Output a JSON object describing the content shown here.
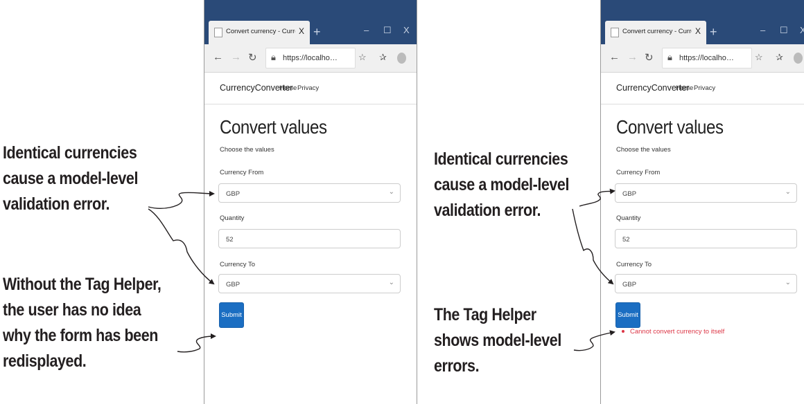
{
  "panels": [
    {
      "annotation_top": [
        "Identical currencies",
        "cause a model-level",
        "validation error."
      ],
      "annotation_bottom": [
        "Without the Tag Helper,",
        "the user has no idea",
        "why the form has been",
        "redisplayed."
      ],
      "browser": {
        "tab_title": "Convert currency - CurrencyConv",
        "tab_close": "X",
        "new_tab": "+",
        "url": "https://localho…",
        "brand": "CurrencyConverter",
        "nav_home": "Home",
        "nav_privacy": "Privacy",
        "heading": "Convert values",
        "subheading": "Choose the values",
        "currency_from_label": "Currency From",
        "currency_from_value": "GBP",
        "quantity_label": "Quantity",
        "quantity_value": "52",
        "currency_to_label": "Currency To",
        "currency_to_value": "GBP",
        "submit_label": "Submit",
        "validation_errors": []
      }
    },
    {
      "annotation_top": [
        "Identical currencies",
        "cause a model-level",
        "validation error."
      ],
      "annotation_bottom": [
        "The Tag Helper",
        "shows model-level",
        "errors."
      ],
      "browser": {
        "tab_title": "Convert currency - CurrencyConv",
        "tab_close": "X",
        "new_tab": "+",
        "url": "https://localho…",
        "brand": "CurrencyConverter",
        "nav_home": "Home",
        "nav_privacy": "Privacy",
        "heading": "Convert values",
        "subheading": "Choose the values",
        "currency_from_label": "Currency From",
        "currency_from_value": "GBP",
        "quantity_label": "Quantity",
        "quantity_value": "52",
        "currency_to_label": "Currency To",
        "currency_to_value": "GBP",
        "submit_label": "Submit",
        "validation_errors": [
          "Cannot convert currency to itself"
        ]
      }
    }
  ],
  "icons": {
    "back": "back-arrow-icon",
    "forward": "forward-arrow-icon",
    "refresh": "refresh-icon",
    "lock": "lock-icon",
    "favorite": "star-icon",
    "favorites_bar": "favorites-icon",
    "profile": "avatar-icon",
    "more": "more-icon",
    "minimize": "minimize-icon",
    "maximize": "maximize-icon",
    "close": "close-icon"
  },
  "colors": {
    "titlebar": "#2a4a78",
    "submit": "#1b6ec2",
    "error": "#dc3545",
    "annotation": "#231f20"
  }
}
